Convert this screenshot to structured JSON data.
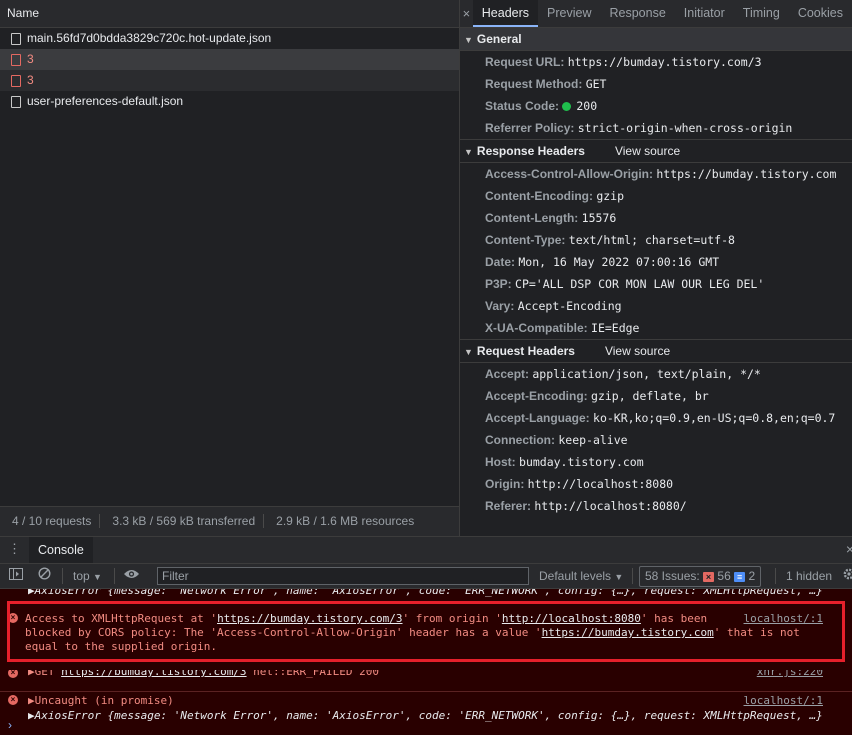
{
  "network": {
    "name_header": "Name",
    "requests": [
      {
        "name": "main.56fd7d0bdda3829c720c.hot-update.json",
        "error": false
      },
      {
        "name": "3",
        "error": true
      },
      {
        "name": "3",
        "error": true
      },
      {
        "name": "user-preferences-default.json",
        "error": false
      }
    ],
    "status": {
      "requests": "4 / 10 requests",
      "transferred": "3.3 kB / 569 kB transferred",
      "resources": "2.9 kB / 1.6 MB resources"
    }
  },
  "details": {
    "close_label": "×",
    "tabs": [
      "Headers",
      "Preview",
      "Response",
      "Initiator",
      "Timing",
      "Cookies"
    ],
    "general": {
      "title": "General",
      "rows": [
        {
          "key": "Request URL:",
          "value": "https://bumday.tistory.com/3"
        },
        {
          "key": "Request Method:",
          "value": "GET"
        },
        {
          "key": "Status Code:",
          "value": "200"
        },
        {
          "key": "Referrer Policy:",
          "value": "strict-origin-when-cross-origin"
        }
      ]
    },
    "response_headers": {
      "title": "Response Headers",
      "view_source": "View source",
      "rows": [
        {
          "key": "Access-Control-Allow-Origin:",
          "value": "https://bumday.tistory.com"
        },
        {
          "key": "Content-Encoding:",
          "value": "gzip"
        },
        {
          "key": "Content-Length:",
          "value": "15576"
        },
        {
          "key": "Content-Type:",
          "value": "text/html; charset=utf-8"
        },
        {
          "key": "Date:",
          "value": "Mon, 16 May 2022 07:00:16 GMT"
        },
        {
          "key": "P3P:",
          "value": "CP='ALL DSP COR MON LAW OUR LEG DEL'"
        },
        {
          "key": "Vary:",
          "value": "Accept-Encoding"
        },
        {
          "key": "X-UA-Compatible:",
          "value": "IE=Edge"
        }
      ]
    },
    "request_headers": {
      "title": "Request Headers",
      "view_source": "View source",
      "rows": [
        {
          "key": "Accept:",
          "value": "application/json, text/plain, */*"
        },
        {
          "key": "Accept-Encoding:",
          "value": "gzip, deflate, br"
        },
        {
          "key": "Accept-Language:",
          "value": "ko-KR,ko;q=0.9,en-US;q=0.8,en;q=0.7"
        },
        {
          "key": "Connection:",
          "value": "keep-alive"
        },
        {
          "key": "Host:",
          "value": "bumday.tistory.com"
        },
        {
          "key": "Origin:",
          "value": "http://localhost:8080"
        },
        {
          "key": "Referer:",
          "value": "http://localhost:8080/"
        }
      ]
    }
  },
  "console": {
    "tab_label": "Console",
    "close_label": "×",
    "context": "top",
    "filter_placeholder": "Filter",
    "levels": "Default levels",
    "issues_label": "58 Issues:",
    "issues_errors": "56",
    "issues_info": "2",
    "hidden": "1 hidden",
    "prompt": "›",
    "messages": {
      "axios_prev": {
        "prefix": "▶AxiosError ",
        "body": "{message: 'Network Error', name: 'AxiosError', code: 'ERR_NETWORK', config: {…}, request: XMLHttpRequest, …}"
      },
      "cors": {
        "part1": "Access to XMLHttpRequest at '",
        "url1": "https://bumday.tistory.com/3",
        "part2": "' from origin '",
        "url2": "http://localhost:8080",
        "part3": "' has been",
        "line2a": "blocked by CORS policy: The 'Access-Control-Allow-Origin' header has a value '",
        "url3": "https://bumday.tistory.com",
        "line2b": "' that is not",
        "line3": "equal to the supplied origin.",
        "source": "localhost/:1"
      },
      "get": {
        "prefix": "▶GET ",
        "url": "https://bumday.tistory.com/3",
        "suffix": " net::ERR_FAILED 200",
        "source": "xhr.js:220"
      },
      "uncaught": {
        "text": "▶Uncaught (in promise)",
        "source": "localhost/:1"
      },
      "axios": {
        "prefix": "▶AxiosError ",
        "body": "{message: 'Network Error', name: 'AxiosError', code: 'ERR_NETWORK', config: {…}, request: XMLHttpRequest, …}"
      }
    }
  }
}
